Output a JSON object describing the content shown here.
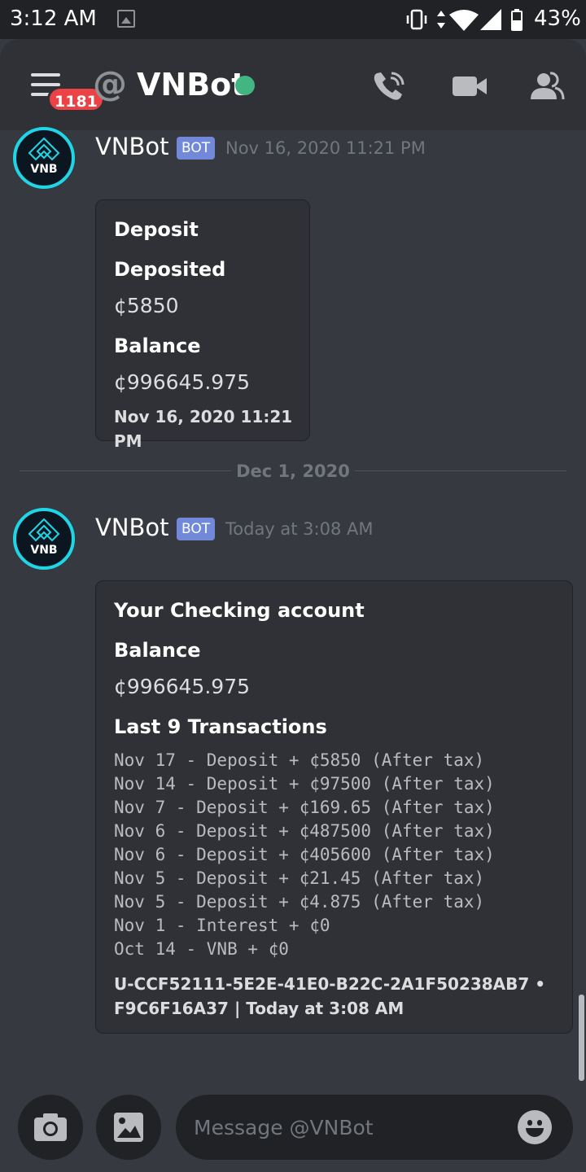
{
  "status_bar": {
    "time": "3:12 AM",
    "battery": "43%",
    "icons": [
      "gallery-icon",
      "vibrate-icon",
      "data-arrows-icon",
      "wifi-icon",
      "signal-icon",
      "battery-icon"
    ]
  },
  "header": {
    "badge_count": "1181",
    "title": "VNBot",
    "status_color": "#43b581",
    "icons": [
      "menu-icon",
      "at-icon",
      "call-icon",
      "video-icon",
      "members-icon"
    ]
  },
  "messages": [
    {
      "author": "VNBot",
      "tag": "BOT",
      "timestamp": "Nov 16, 2020 11:21 PM",
      "avatar_text": "VNB",
      "embed": {
        "title": "Deposit",
        "fields": [
          {
            "name": "Deposited",
            "value": "¢5850"
          },
          {
            "name": "Balance",
            "value": "¢996645.975"
          }
        ],
        "footer": "Nov 16, 2020 11:21 PM"
      }
    },
    {
      "author": "VNBot",
      "tag": "BOT",
      "timestamp": "Today at 3:08 AM",
      "avatar_text": "VNB",
      "embed": {
        "title": "Your Checking account",
        "fields": [
          {
            "name": "Balance",
            "value": "¢996645.975"
          },
          {
            "name": "Last 9 Transactions",
            "lines": [
              "Nov 17 - Deposit + ¢5850 (After tax)",
              "Nov 14 - Deposit + ¢97500 (After tax)",
              "Nov 7 - Deposit + ¢169.65 (After tax)",
              "Nov 6 - Deposit + ¢487500 (After tax)",
              "Nov 6 - Deposit + ¢405600 (After tax)",
              "Nov 5 - Deposit + ¢21.45 (After tax)",
              "Nov 5 - Deposit + ¢4.875 (After tax)",
              "Nov 1 - Interest + ¢0",
              "Oct 14 - VNB + ¢0"
            ]
          }
        ],
        "footer_line1": "U-CCF52111-5E2E-41E0-B22C-2A1F50238AB7 •",
        "footer_line2": "F9C6F16A37 | Today at 3:08 AM"
      }
    }
  ],
  "date_divider": "Dec 1, 2020",
  "composer": {
    "placeholder": "Message @VNBot",
    "icons": [
      "camera-icon",
      "image-icon",
      "emoji-icon"
    ]
  },
  "colors": {
    "background": "#36393f",
    "header": "#2f3136",
    "embed": "#2f3136",
    "bot_tag": "#7289da",
    "badge": "#ed4245",
    "avatar_ring": "#1fd6e6"
  }
}
